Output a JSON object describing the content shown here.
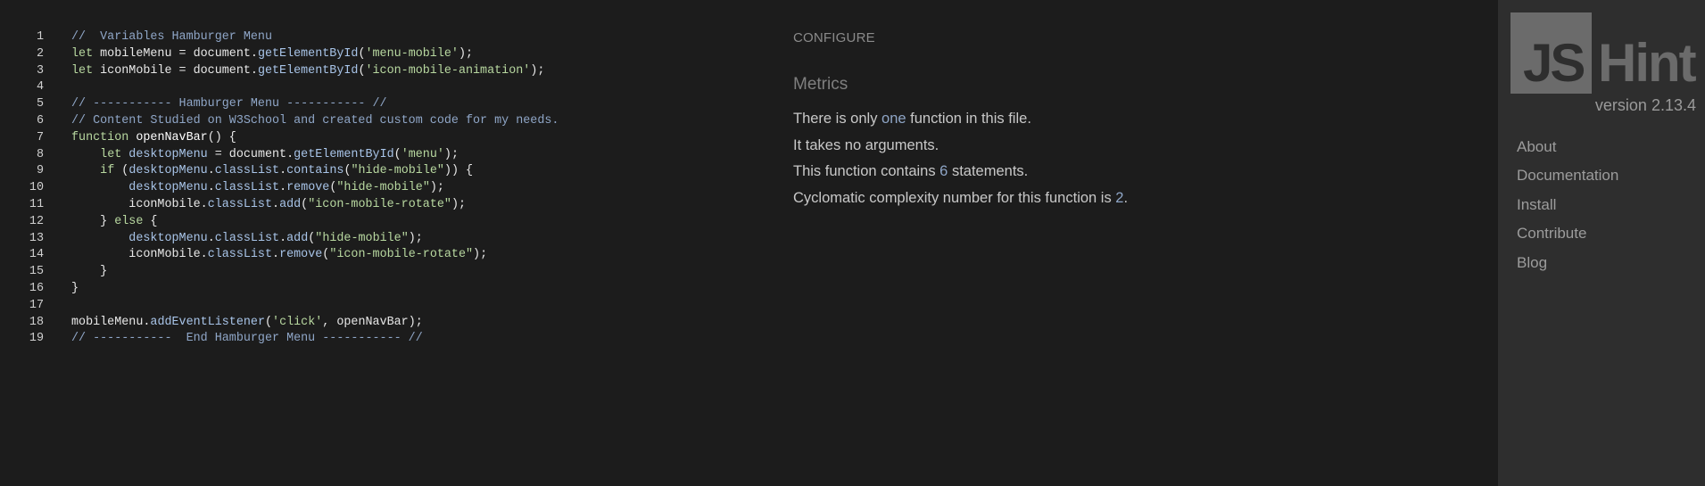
{
  "editor": {
    "lines": [
      {
        "n": "1",
        "tokens": [
          [
            "comment",
            "//  Variables Hamburger Menu"
          ]
        ]
      },
      {
        "n": "2",
        "tokens": [
          [
            "kw",
            "let"
          ],
          [
            "plain",
            " mobileMenu = document."
          ],
          [
            "prop",
            "getElementById"
          ],
          [
            "plain",
            "("
          ],
          [
            "str",
            "'menu-mobile'"
          ],
          [
            "plain",
            ");"
          ]
        ]
      },
      {
        "n": "3",
        "tokens": [
          [
            "kw",
            "let"
          ],
          [
            "plain",
            " iconMobile = document."
          ],
          [
            "prop",
            "getElementById"
          ],
          [
            "plain",
            "("
          ],
          [
            "str",
            "'icon-mobile-animation'"
          ],
          [
            "plain",
            ");"
          ]
        ]
      },
      {
        "n": "4",
        "tokens": []
      },
      {
        "n": "5",
        "tokens": [
          [
            "comment",
            "// ----------- Hamburger Menu ----------- //"
          ]
        ]
      },
      {
        "n": "6",
        "tokens": [
          [
            "comment",
            "// Content Studied on W3School and created custom code for my needs."
          ]
        ]
      },
      {
        "n": "7",
        "tokens": [
          [
            "kw",
            "function"
          ],
          [
            "fn",
            " openNavBar"
          ],
          [
            "plain",
            "() {"
          ]
        ]
      },
      {
        "n": "8",
        "tokens": [
          [
            "plain",
            "    "
          ],
          [
            "kw",
            "let"
          ],
          [
            "var",
            " desktopMenu"
          ],
          [
            "plain",
            " = document."
          ],
          [
            "prop",
            "getElementById"
          ],
          [
            "plain",
            "("
          ],
          [
            "str",
            "'menu'"
          ],
          [
            "plain",
            ");"
          ]
        ]
      },
      {
        "n": "9",
        "tokens": [
          [
            "plain",
            "    "
          ],
          [
            "kw",
            "if"
          ],
          [
            "plain",
            " ("
          ],
          [
            "var",
            "desktopMenu"
          ],
          [
            "plain",
            "."
          ],
          [
            "prop",
            "classList"
          ],
          [
            "plain",
            "."
          ],
          [
            "prop",
            "contains"
          ],
          [
            "plain",
            "("
          ],
          [
            "str",
            "\"hide-mobile\""
          ],
          [
            "plain",
            ")) {"
          ]
        ]
      },
      {
        "n": "10",
        "tokens": [
          [
            "plain",
            "        "
          ],
          [
            "var",
            "desktopMenu"
          ],
          [
            "plain",
            "."
          ],
          [
            "prop",
            "classList"
          ],
          [
            "plain",
            "."
          ],
          [
            "prop",
            "remove"
          ],
          [
            "plain",
            "("
          ],
          [
            "str",
            "\"hide-mobile\""
          ],
          [
            "plain",
            ");"
          ]
        ]
      },
      {
        "n": "11",
        "tokens": [
          [
            "plain",
            "        iconMobile."
          ],
          [
            "prop",
            "classList"
          ],
          [
            "plain",
            "."
          ],
          [
            "prop",
            "add"
          ],
          [
            "plain",
            "("
          ],
          [
            "str",
            "\"icon-mobile-rotate\""
          ],
          [
            "plain",
            ");"
          ]
        ]
      },
      {
        "n": "12",
        "tokens": [
          [
            "plain",
            "    } "
          ],
          [
            "kw",
            "else"
          ],
          [
            "plain",
            " {"
          ]
        ]
      },
      {
        "n": "13",
        "tokens": [
          [
            "plain",
            "        "
          ],
          [
            "var",
            "desktopMenu"
          ],
          [
            "plain",
            "."
          ],
          [
            "prop",
            "classList"
          ],
          [
            "plain",
            "."
          ],
          [
            "prop",
            "add"
          ],
          [
            "plain",
            "("
          ],
          [
            "str",
            "\"hide-mobile\""
          ],
          [
            "plain",
            ");"
          ]
        ]
      },
      {
        "n": "14",
        "tokens": [
          [
            "plain",
            "        iconMobile."
          ],
          [
            "prop",
            "classList"
          ],
          [
            "plain",
            "."
          ],
          [
            "prop",
            "remove"
          ],
          [
            "plain",
            "("
          ],
          [
            "str",
            "\"icon-mobile-rotate\""
          ],
          [
            "plain",
            ");"
          ]
        ]
      },
      {
        "n": "15",
        "tokens": [
          [
            "plain",
            "    }"
          ]
        ]
      },
      {
        "n": "16",
        "tokens": [
          [
            "plain",
            "}"
          ]
        ]
      },
      {
        "n": "17",
        "tokens": []
      },
      {
        "n": "18",
        "tokens": [
          [
            "plain",
            "mobileMenu."
          ],
          [
            "prop",
            "addEventListener"
          ],
          [
            "plain",
            "("
          ],
          [
            "str",
            "'click'"
          ],
          [
            "plain",
            ", openNavBar);"
          ]
        ]
      },
      {
        "n": "19",
        "tokens": [
          [
            "comment",
            "// -----------  End Hamburger Menu ----------- //"
          ]
        ]
      }
    ]
  },
  "report": {
    "configure_label": "CONFIGURE",
    "metrics_title": "Metrics",
    "metrics": [
      {
        "pre": "There is only ",
        "num": "one",
        "post": " function in this file."
      },
      {
        "pre": "It takes no arguments.",
        "num": "",
        "post": ""
      },
      {
        "pre": "This function contains ",
        "num": "6",
        "post": " statements."
      },
      {
        "pre": "Cyclomatic complexity number for this function is ",
        "num": "2",
        "post": "."
      }
    ]
  },
  "sidebar": {
    "logo_left": "JS",
    "logo_right": "Hint",
    "version": "version 2.13.4",
    "nav": [
      "About",
      "Documentation",
      "Install",
      "Contribute",
      "Blog"
    ]
  },
  "colors": {
    "background": "#1c1c1c",
    "sidebar": "#2e2e2e",
    "comment": "#8fa6c7",
    "string": "#b8d8a0"
  }
}
